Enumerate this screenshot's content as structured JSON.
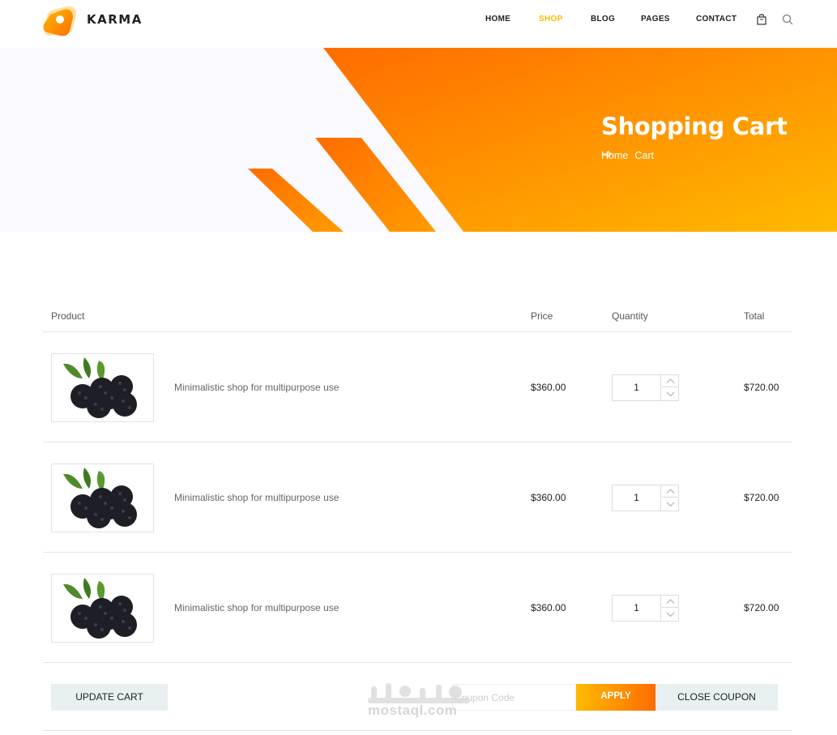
{
  "header": {
    "brand": "KARMA",
    "nav": [
      {
        "label": "HOME",
        "active": false
      },
      {
        "label": "SHOP",
        "active": true
      },
      {
        "label": "BLOG",
        "active": false
      },
      {
        "label": "PAGES",
        "active": false
      },
      {
        "label": "CONTACT",
        "active": false
      }
    ],
    "icons": [
      "bag-icon",
      "search-icon"
    ]
  },
  "banner": {
    "title": "Shopping Cart",
    "breadcrumb": [
      "Home",
      "Cart"
    ]
  },
  "cart": {
    "columns": {
      "product": "Product",
      "price": "Price",
      "quantity": "Quantity",
      "total": "Total"
    },
    "items": [
      {
        "name": "Minimalistic shop for multipurpose use",
        "price": "$360.00",
        "quantity": "1",
        "total": "$720.00"
      },
      {
        "name": "Minimalistic shop for multipurpose use",
        "price": "$360.00",
        "quantity": "1",
        "total": "$720.00"
      },
      {
        "name": "Minimalistic shop for multipurpose use",
        "price": "$360.00",
        "quantity": "1",
        "total": "$720.00"
      }
    ],
    "update_label": "UPDATE CART",
    "coupon_placeholder": "Coupon Code",
    "apply_label": "APPLY",
    "close_coupon_label": "CLOSE COUPON"
  },
  "watermark": {
    "text": "mostaql.com"
  },
  "colors": {
    "accent": "#ffba00",
    "accent_dark": "#ff6c00",
    "banner_bg": "#f9f9ff",
    "button_grey": "#e8f0f2"
  }
}
